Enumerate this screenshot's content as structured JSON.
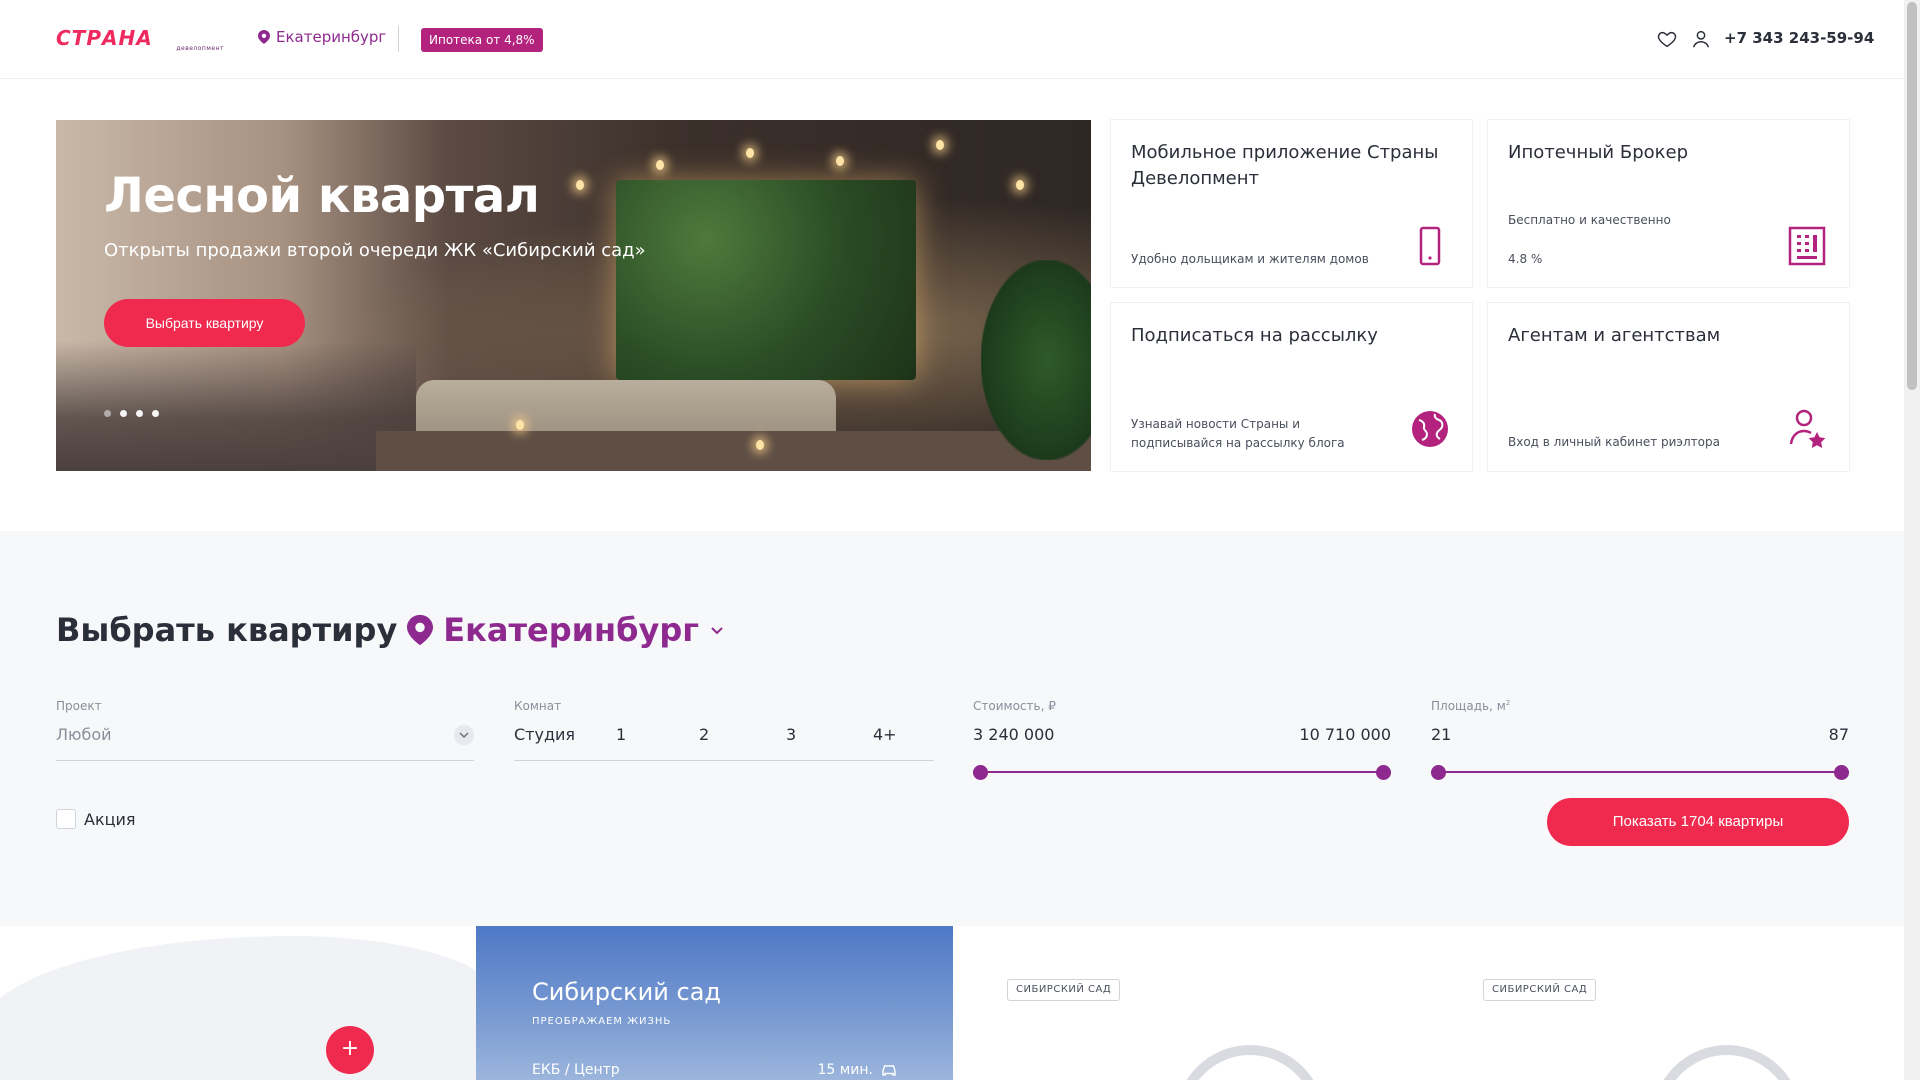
{
  "header": {
    "logo_text": "СТРАНА",
    "logo_sub": "девелопмент",
    "city": "Екатеринбург",
    "mortgage_badge": "Ипотека от 4,8%",
    "phone": "+7 343 243-59-94"
  },
  "hero": {
    "title": "Лесной квартал",
    "subtitle": "Открыты продажи второй очереди ЖК «Сибирский сад»",
    "button": "Выбрать квартиру",
    "slides_count": 4,
    "active_slide": 1
  },
  "cards": [
    {
      "title": "Мобильное приложение Страны Девелопмент",
      "text": "Удобно дольщикам и жителям домов",
      "icon": "phone-icon"
    },
    {
      "title": "Ипотечный Брокер",
      "text_top": "Бесплатно и качественно",
      "text": "4.8 %",
      "icon": "calculator-icon"
    },
    {
      "title": "Подписаться на рассылку",
      "text": "Узнавай новости Страны и подписывайся на рассылку блога",
      "icon": "globe-icon"
    },
    {
      "title": "Агентам и агентствам",
      "text": "Вход в личный кабинет риэлтора",
      "icon": "agent-star-icon"
    }
  ],
  "search": {
    "title": "Выбрать квартиру",
    "city": "Екатеринбург",
    "project_label": "Проект",
    "project_value": "Любой",
    "rooms_label": "Комнат",
    "rooms": [
      "Студия",
      "1",
      "2",
      "3",
      "4+"
    ],
    "price_label": "Стоимость, ₽",
    "price_min": "3 240 000",
    "price_max": "10 710 000",
    "area_label": "Площадь, м",
    "area_sup": "2",
    "area_min": "21",
    "area_max": "87",
    "promo_label": "Акция",
    "show_button": "Показать 1704 квартиры"
  },
  "bottom": {
    "map_plus": "+",
    "project_title": "Сибирский сад",
    "project_sub": "ПРЕОБРАЖАЕМ ЖИЗНЬ",
    "project_loc": "ЕКБ / Центр",
    "project_time": "15 мин.",
    "tag1": "СИБИРСКИЙ САД",
    "tag2": "СИБИРСКИЙ САД"
  },
  "colors": {
    "accent": "#ef2a4e",
    "brand_purple": "#8e2a8f",
    "badge": "#b3237e"
  }
}
